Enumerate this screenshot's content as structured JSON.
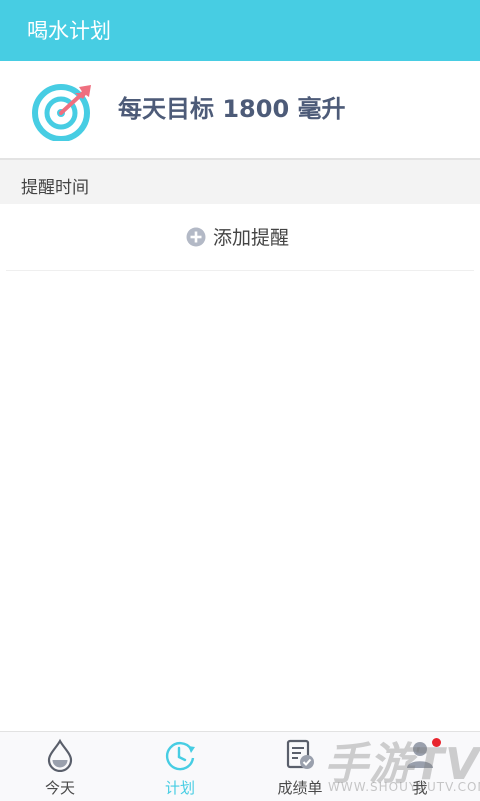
{
  "header": {
    "title": "喝水计划"
  },
  "goal": {
    "text": "每天目标 1800 毫升",
    "icon": "target-icon"
  },
  "reminders": {
    "section_label": "提醒时间",
    "add_label": "添加提醒",
    "add_icon": "plus-circle-icon"
  },
  "tabs": [
    {
      "label": "今天",
      "icon": "water-drop-icon",
      "active": false
    },
    {
      "label": "计划",
      "icon": "clock-icon",
      "active": true
    },
    {
      "label": "成绩单",
      "icon": "report-icon",
      "active": false
    },
    {
      "label": "我",
      "icon": "user-icon",
      "active": false,
      "badge": true
    }
  ],
  "watermark": {
    "text": "手游TV",
    "sub": "WWW.SHOUYOUTV.COM"
  },
  "colors": {
    "accent": "#47cde3",
    "text_dark": "#4d5b78",
    "badge": "#e8242d",
    "target_red": "#ef6f7f"
  }
}
